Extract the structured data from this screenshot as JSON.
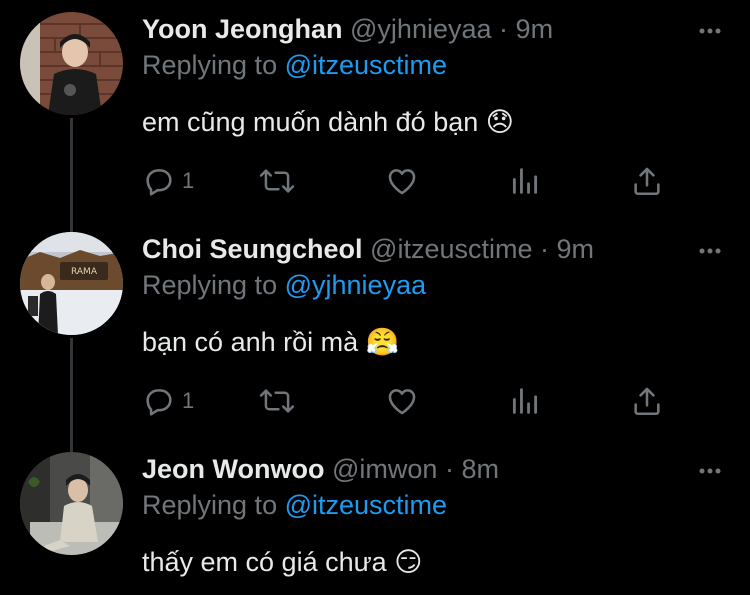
{
  "tweets": [
    {
      "name": "Yoon Jeonghan",
      "handle": "@yjhnieyaa",
      "separator": "·",
      "time": "9m",
      "replying_prefix": "Replying to",
      "replying_to": "@itzeusctime",
      "text": "em cũng muốn dành đó bạn 😞",
      "reply_count": "1"
    },
    {
      "name": "Choi Seungcheol",
      "handle": "@itzeusctime",
      "separator": "·",
      "time": "9m",
      "replying_prefix": "Replying to",
      "replying_to": "@yjhnieyaa",
      "text": "bạn có anh rồi mà 😤",
      "reply_count": "1"
    },
    {
      "name": "Jeon Wonwoo",
      "handle": "@imwon",
      "separator": "·",
      "time": "8m",
      "replying_prefix": "Replying to",
      "replying_to": "@itzeusctime",
      "text": "thấy em có giá chưa 😏"
    }
  ],
  "icons": {
    "more": "more-horizontal-icon",
    "reply": "reply-icon",
    "retweet": "retweet-icon",
    "like": "heart-icon",
    "views": "analytics-icon",
    "share": "share-icon"
  },
  "colors": {
    "background": "#000000",
    "primary_text": "#e7e9ea",
    "secondary_text": "#71767b",
    "accent": "#1d9bf0"
  }
}
